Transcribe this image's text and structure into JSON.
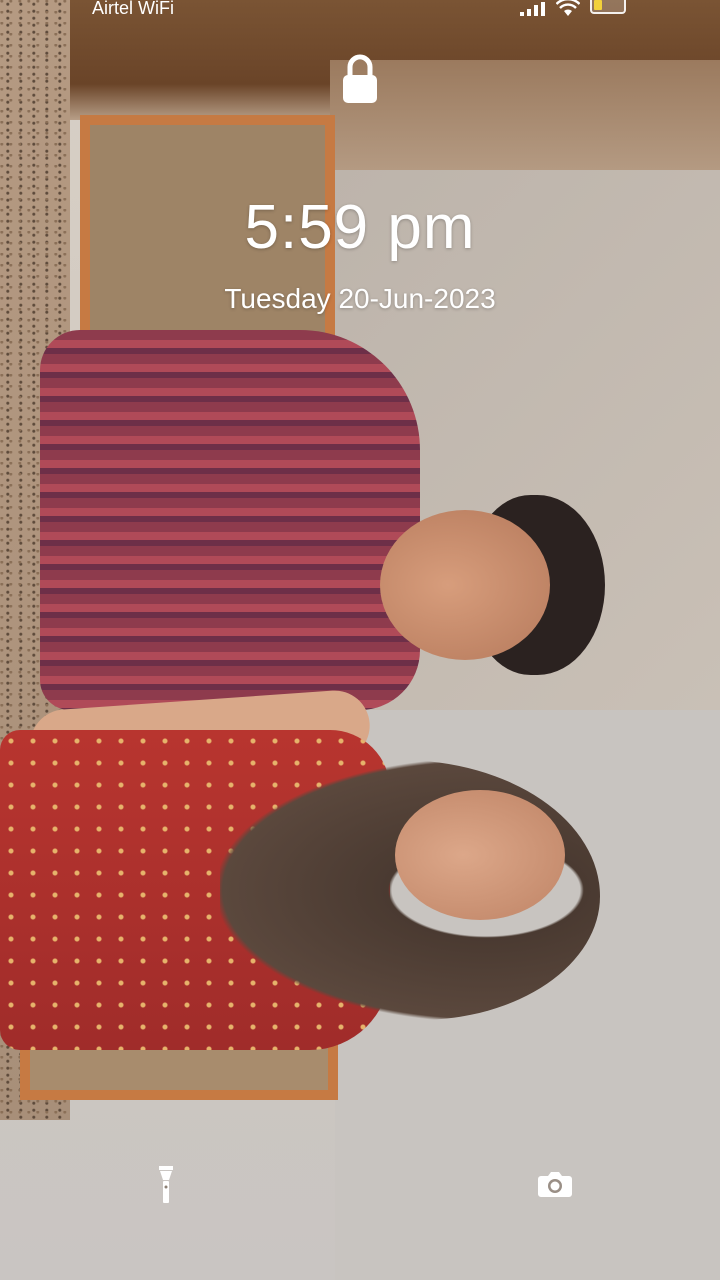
{
  "status_bar": {
    "carrier": "Airtel WiFi",
    "icons": [
      "signal-icon",
      "wifi-icon",
      "battery-icon"
    ],
    "battery_color": "#f2d13a"
  },
  "lock_screen": {
    "lock_icon": "lock-icon",
    "time": "5:59 pm",
    "date": "Tuesday 20-Jun-2023",
    "shortcuts": [
      "flashlight-icon",
      "camera-icon"
    ]
  },
  "colors": {
    "text": "#ffffff"
  }
}
